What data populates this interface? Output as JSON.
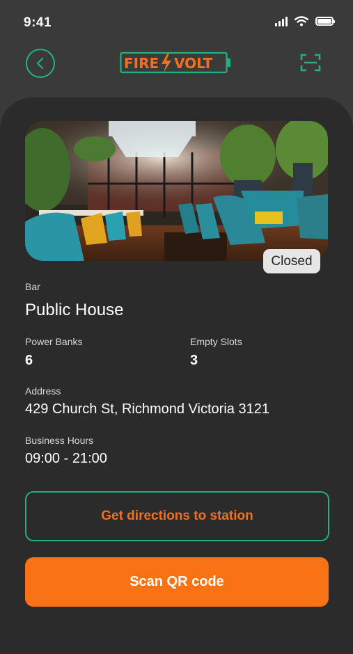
{
  "status_bar": {
    "time": "9:41"
  },
  "header": {
    "logo_text_left": "FIRE",
    "logo_text_right": "VOLT"
  },
  "station": {
    "category": "Bar",
    "name": "Public House",
    "status": "Closed",
    "power_banks_label": "Power Banks",
    "power_banks_value": "6",
    "empty_slots_label": "Empty Slots",
    "empty_slots_value": "3",
    "address_label": "Address",
    "address_value": "429 Church St, Richmond Victoria 3121",
    "hours_label": "Business Hours",
    "hours_value": "09:00 - 21:00"
  },
  "actions": {
    "directions_label": "Get directions to station",
    "scan_label": "Scan QR code"
  },
  "colors": {
    "accent_green": "#23b27e",
    "accent_orange": "#f97316",
    "card_bg": "#2b2b2b",
    "page_bg": "#3a3a3a"
  },
  "icons": {
    "back": "chevron-left-icon",
    "scan": "qr-scan-icon"
  }
}
